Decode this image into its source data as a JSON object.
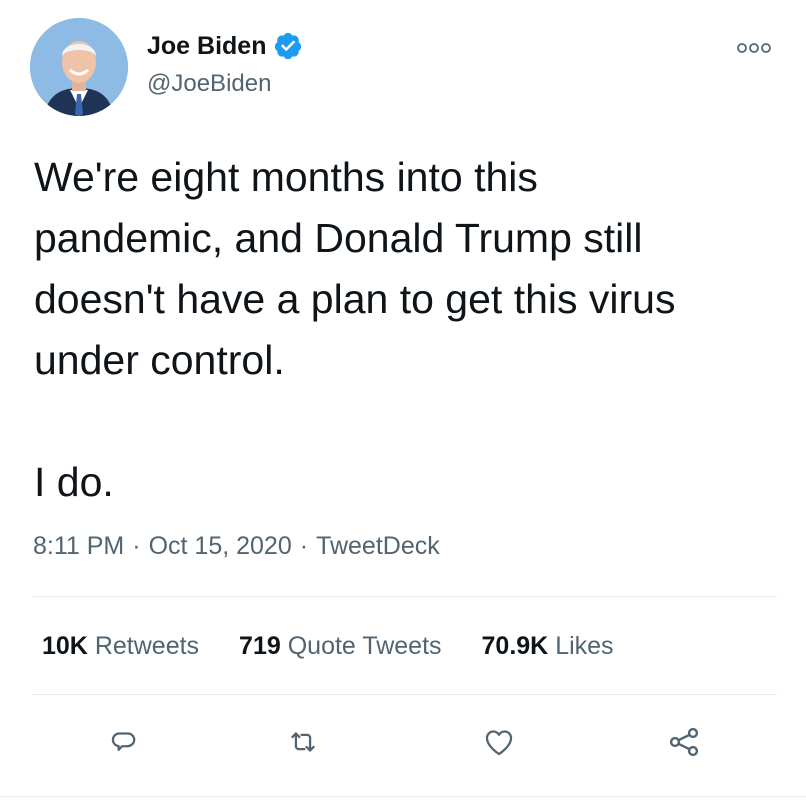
{
  "author": {
    "name": "Joe Biden",
    "handle": "@JoeBiden",
    "verified": true
  },
  "tweet": {
    "text": "We're eight months into this\npandemic, and Donald Trump still\ndoesn't have a plan to get this virus\nunder control.\n\nI do.",
    "time": "8:11 PM",
    "date": "Oct 15, 2020",
    "source": "TweetDeck",
    "separator": "·"
  },
  "stats": {
    "retweets": {
      "count": "10K",
      "label": "Retweets"
    },
    "quotes": {
      "count": "719",
      "label": "Quote Tweets"
    },
    "likes": {
      "count": "70.9K",
      "label": "Likes"
    }
  },
  "icons": {
    "more": "more-icon",
    "reply": "reply-icon",
    "retweet": "retweet-icon",
    "like": "like-icon",
    "share": "share-icon",
    "verified": "verified-badge-icon"
  },
  "colors": {
    "text": "#0f1419",
    "secondary": "#536471",
    "verified": "#1d9bf0",
    "divider": "#e6ecf0"
  }
}
